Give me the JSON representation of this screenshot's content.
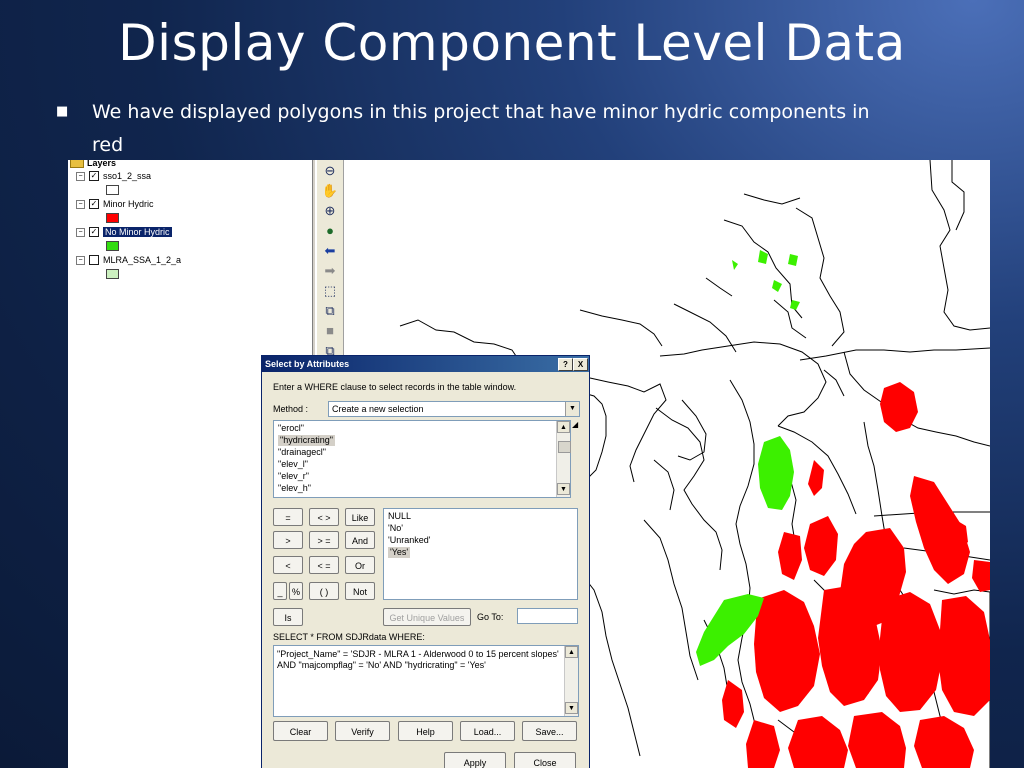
{
  "slide": {
    "title": "Display Component Level Data",
    "bullet_mark": "■",
    "bullet": "We have displayed polygons in this project that have minor hydric components in red"
  },
  "toc": {
    "header": "Layers",
    "layers": [
      {
        "label": "sso1_2_ssa",
        "checked": true,
        "swatch": "#ffffff"
      },
      {
        "label": "Minor Hydric",
        "checked": true,
        "swatch": "#ff0000"
      },
      {
        "label": "No Minor Hydric",
        "checked": true,
        "swatch": "#33dd11",
        "selected": true
      },
      {
        "label": "MLRA_SSA_1_2_a",
        "checked": false,
        "swatch": "#ccf0c0"
      }
    ]
  },
  "toolbar": {
    "tools": [
      "zoom-out-icon",
      "pan-icon",
      "zoom-in-icon",
      "globe-icon",
      "back-icon",
      "forward-icon",
      "select-features-icon",
      "select-elements-icon",
      "stop-icon",
      "identify-icon"
    ]
  },
  "dialog": {
    "title": "Select by Attributes",
    "help_btn": "?",
    "close_btn": "X",
    "instruction": "Enter a WHERE clause to select records in the table window.",
    "method_label": "Method :",
    "method_value": "Create a new selection",
    "fields": [
      "\"erocl\"",
      "\"hydricrating\"",
      "\"drainagecl\"",
      "\"elev_l\"",
      "\"elev_r\"",
      "\"elev_h\""
    ],
    "values": [
      "NULL",
      "'No'",
      "'Unranked'",
      "'Yes'"
    ],
    "operators": {
      "eq": "=",
      "neq": "< >",
      "like": "Like",
      "gt": ">",
      "gte": "> =",
      "and": "And",
      "lt": "<",
      "lte": "< =",
      "or": "Or",
      "underscore": "_",
      "percent": "%",
      "paren": "( )",
      "not": "Not",
      "is": "Is"
    },
    "get_unique": "Get Unique Values",
    "goto_label": "Go To:",
    "goto_value": "",
    "select_label": "SELECT * FROM SDJRdata WHERE:",
    "query": "\"Project_Name\" =  'SDJR - MLRA 1 - Alderwood 0 to 15 percent slopes' AND \"majcompflag\" = 'No' AND \"hydricrating\" = 'Yes'",
    "buttons": {
      "clear": "Clear",
      "verify": "Verify",
      "help": "Help",
      "load": "Load...",
      "save": "Save...",
      "apply": "Apply",
      "close": "Close"
    }
  },
  "colors": {
    "minor_hydric": "#ff0000",
    "no_minor_hydric": "#33dd11",
    "selection": "#0a246a"
  }
}
